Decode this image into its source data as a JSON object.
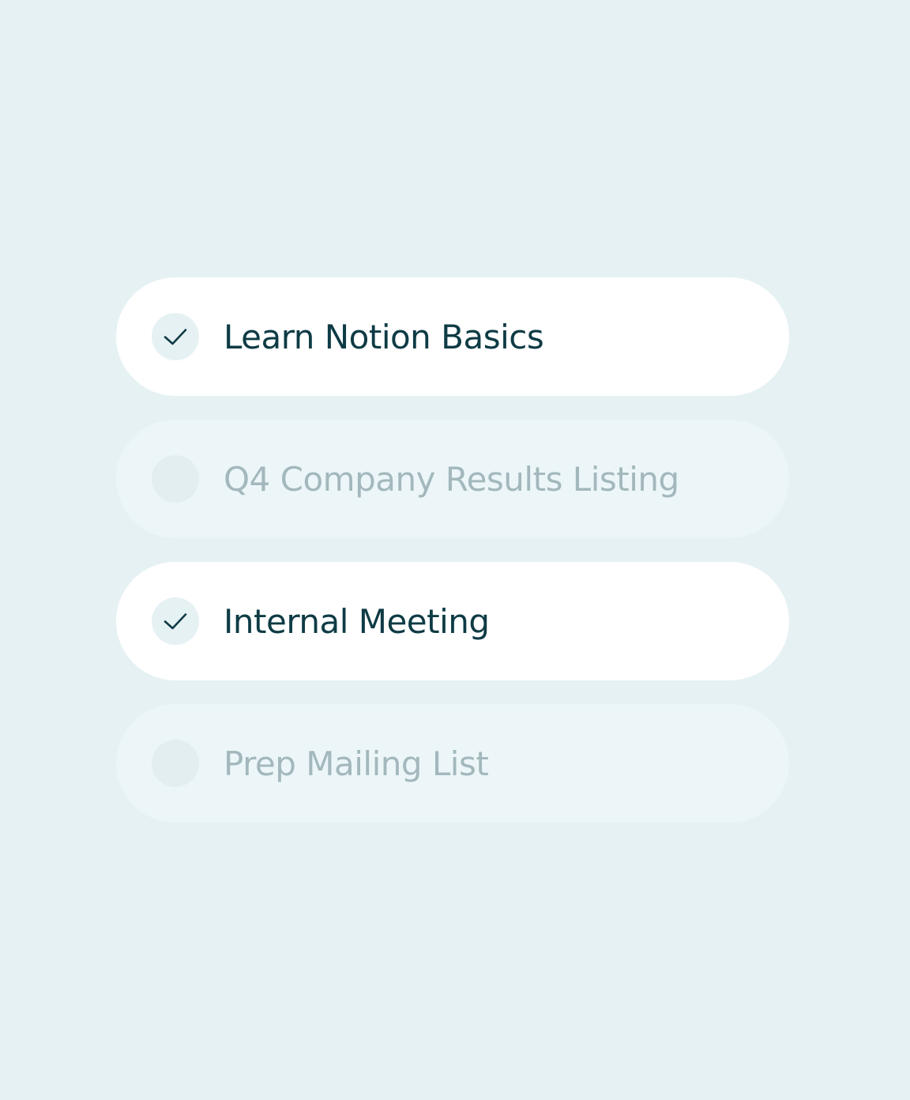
{
  "colors": {
    "background": "#e6f1f4",
    "card_checked": "#ffffff",
    "card_unchecked": "#ecf6f9",
    "text_checked": "#0e3b45",
    "text_unchecked": "#a3b8bc",
    "checkmark": "#0e3b45"
  },
  "tasks": [
    {
      "label": "Learn Notion Basics",
      "checked": true,
      "icon": "check-icon"
    },
    {
      "label": "Q4 Company Results Listing",
      "checked": false,
      "icon": null
    },
    {
      "label": "Internal Meeting",
      "checked": true,
      "icon": "check-icon"
    },
    {
      "label": "Prep Mailing List",
      "checked": false,
      "icon": null
    }
  ]
}
